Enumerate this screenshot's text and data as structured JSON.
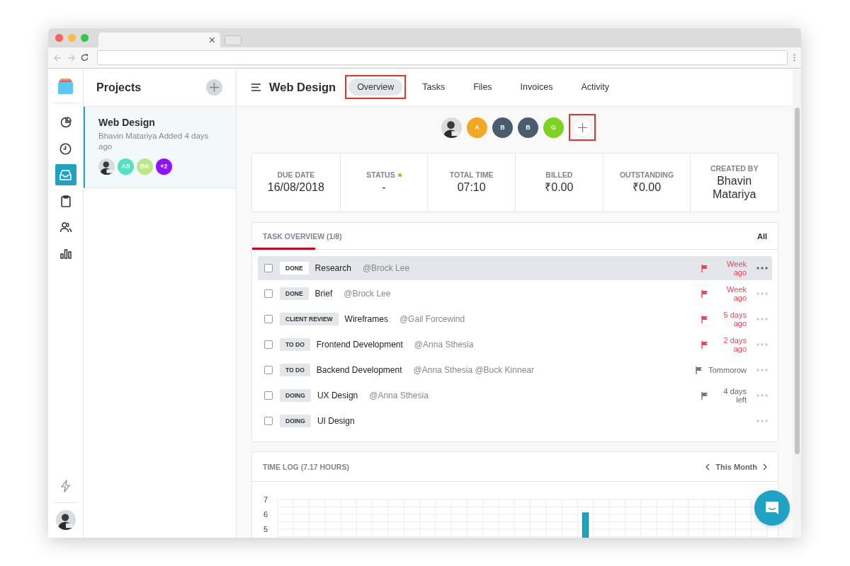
{
  "rail": {
    "items": [
      {
        "kind": "pie",
        "selected": false
      },
      {
        "kind": "clock",
        "selected": false
      },
      {
        "kind": "inbox",
        "selected": true
      },
      {
        "kind": "clipboard",
        "selected": false
      },
      {
        "kind": "people",
        "selected": false
      },
      {
        "kind": "bars",
        "selected": false
      }
    ]
  },
  "projects_panel": {
    "title": "Projects",
    "projects": [
      {
        "name": "Web Design",
        "meta": "Bhavin Matariya Added 4 days ago",
        "selected": true,
        "members": [
          {
            "kind": "photo"
          },
          {
            "kind": "initials",
            "initials": "AS",
            "color": "#50e3c2"
          },
          {
            "kind": "initials",
            "initials": "BK",
            "color": "#b8e986"
          },
          {
            "kind": "initials",
            "initials": "+2",
            "color": "#9013fe"
          }
        ]
      }
    ]
  },
  "project": {
    "title": "Web Design",
    "tabs": [
      {
        "label": "Overview",
        "selected": true,
        "highlighted": true
      },
      {
        "label": "Tasks",
        "selected": false,
        "highlighted": false
      },
      {
        "label": "Files",
        "selected": false,
        "highlighted": false
      },
      {
        "label": "Invoices",
        "selected": false,
        "highlighted": false
      },
      {
        "label": "Activity",
        "selected": false,
        "highlighted": false
      }
    ],
    "members": [
      {
        "kind": "photo"
      },
      {
        "kind": "initials",
        "initials": "A",
        "color": "#f5a623"
      },
      {
        "kind": "initials",
        "initials": "B",
        "color": "#4a5d70"
      },
      {
        "kind": "initials",
        "initials": "B",
        "color": "#4a5d70"
      },
      {
        "kind": "initials",
        "initials": "G",
        "color": "#7ed321"
      }
    ],
    "add_member": {
      "highlighted": true
    }
  },
  "stats": [
    {
      "label": "DUE DATE",
      "value": "16/08/2018"
    },
    {
      "label": "STATUS",
      "value": "-",
      "color": "#7ed321"
    },
    {
      "label": "TOTAL TIME",
      "value": "07:10"
    },
    {
      "label": "BILLED",
      "value": "₹0.00"
    },
    {
      "label": "OUTSTANDING",
      "value": "₹0.00"
    },
    {
      "label": "CREATED BY",
      "value": "Bhavin Matariya"
    }
  ],
  "task_overview": {
    "title": "TASK OVERVIEW (1/8)",
    "filter": "All",
    "tasks": [
      {
        "status": "DONE",
        "name": "Research",
        "assignees": "@Brock Lee",
        "due": "Week ago",
        "overdue": true,
        "checked": false,
        "selected": true
      },
      {
        "status": "DONE",
        "name": "Brief",
        "assignees": "@Brock Lee",
        "due": "Week ago",
        "overdue": true,
        "checked": false,
        "selected": false
      },
      {
        "status": "CLIENT REVIEW",
        "name": "Wireframes",
        "assignees": "@Gail Forcewind",
        "due": "5 days ago",
        "overdue": true,
        "checked": false,
        "selected": false
      },
      {
        "status": "TO DO",
        "name": "Frontend Development",
        "assignees": "@Anna Sthesia",
        "due": "2 days ago",
        "overdue": true,
        "checked": false,
        "selected": false
      },
      {
        "status": "TO DO",
        "name": "Backend Development",
        "assignees": "@Anna Sthesia @Buck Kinnear",
        "due": "Tommorow",
        "overdue": false,
        "checked": false,
        "selected": false
      },
      {
        "status": "DOING",
        "name": "UX Design",
        "assignees": "@Anna Sthesia",
        "due": "4 days left",
        "overdue": false,
        "checked": false,
        "selected": false
      },
      {
        "status": "DOING",
        "name": "UI Design",
        "checked": false,
        "selected": false
      }
    ]
  },
  "time_log": {
    "title": "TIME LOG (7.17 HOURS)",
    "period": "This Month",
    "chart_data": {
      "type": "bar",
      "ylim": [
        4,
        7
      ],
      "yticks": [
        5,
        6,
        7
      ],
      "series": [
        {
          "color": "#1fa2c4",
          "values": [
            null,
            null,
            null,
            null,
            null,
            null,
            null,
            null,
            null,
            null,
            null,
            null,
            null,
            null,
            null,
            null,
            null,
            null,
            null,
            6.1,
            null,
            null,
            null,
            null,
            null,
            null,
            null,
            null,
            null,
            null,
            null
          ]
        }
      ]
    }
  }
}
